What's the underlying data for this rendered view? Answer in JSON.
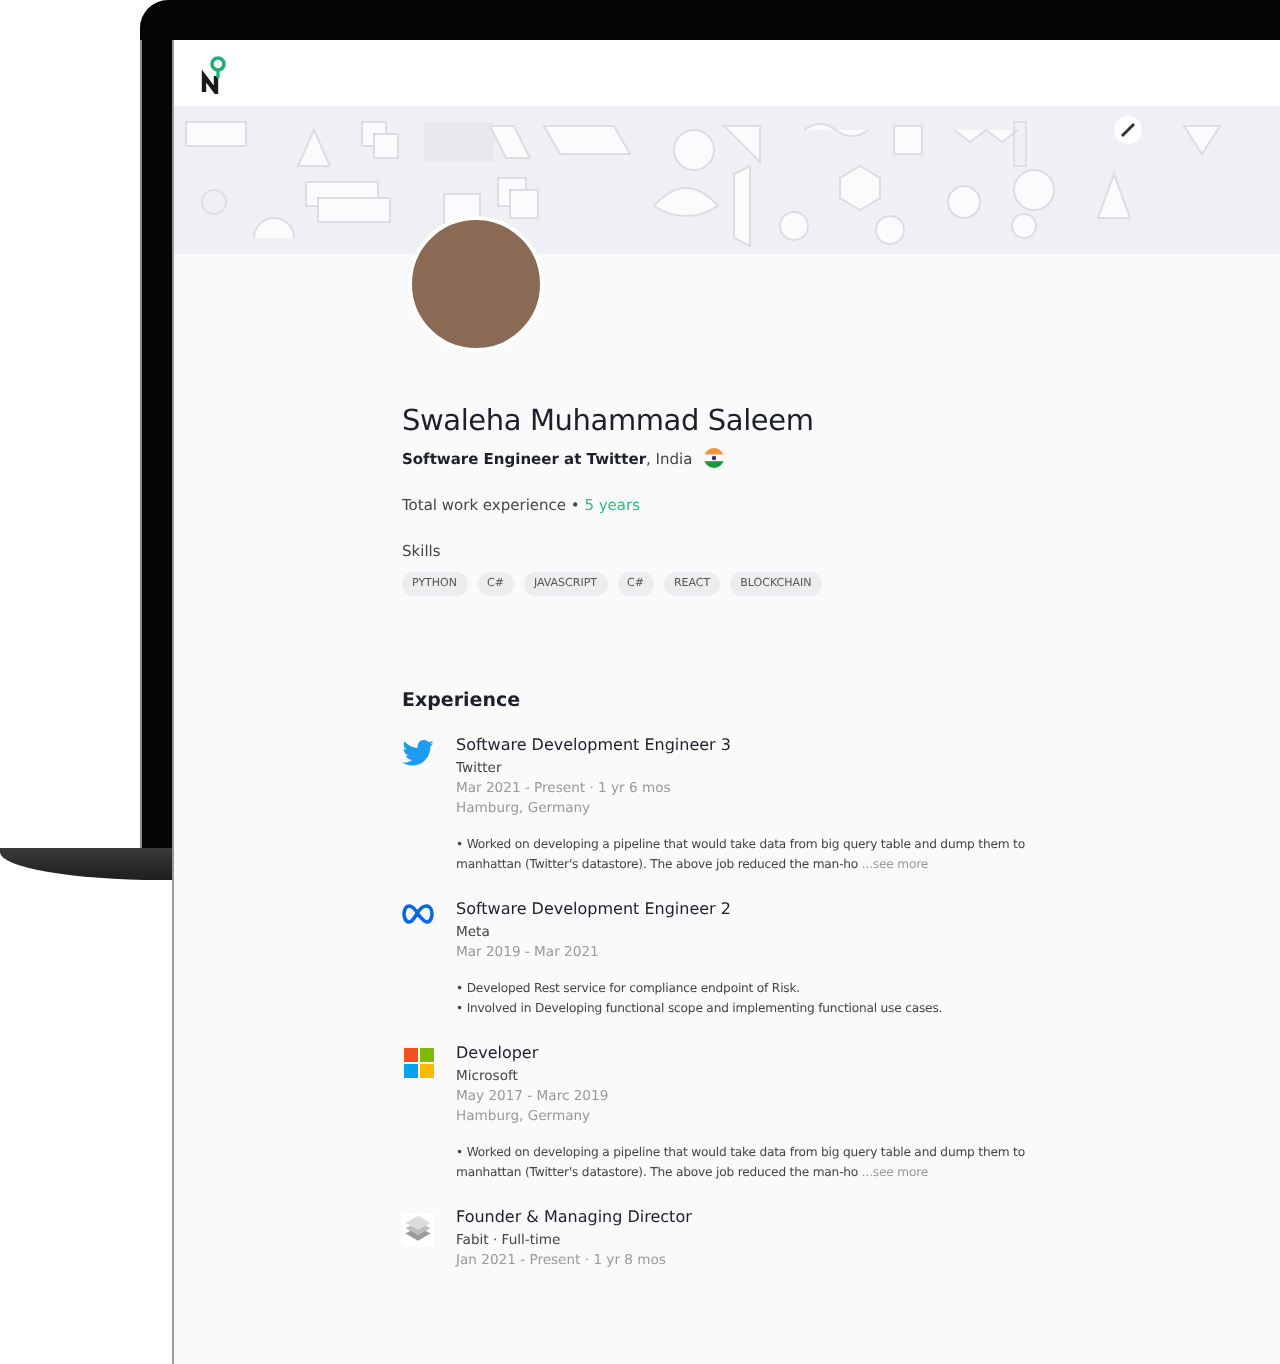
{
  "profile": {
    "name": "Swaleha Muhammad Saleem",
    "headline": "**Software Engineer at Twitter**, India",
    "experience_label": "Total work experience • ",
    "experience_value": "5 years",
    "skills_label": "Skills",
    "skills": [
      "PYTHON",
      "C#",
      "JAVASCRIPT",
      "C#",
      "REACT",
      "BLOCKCHAIN"
    ]
  },
  "experience": {
    "heading": "Experience",
    "items": [
      {
        "kind": "twitter",
        "title": "Software Development Engineer 3",
        "company": "Twitter",
        "dates": "Mar 2021 - Present · 1 yr 6 mos",
        "location": "Hamburg, Germany",
        "bullets": [
          "• Worked on developing a pipeline that would take data from big query table and dump them to manhattan (Twitter's datastore). The above job reduced the man-ho"
        ],
        "see_more": "...see more"
      },
      {
        "kind": "meta",
        "title": "Software Development Engineer 2",
        "company": "Meta",
        "dates": "Mar 2019 - Mar 2021",
        "bullets": [
          "• Developed Rest service for compliance endpoint of Risk.",
          "• Involved in Developing functional scope and implementing functional use cases."
        ]
      },
      {
        "kind": "microsoft",
        "title": "Developer",
        "company": "Microsoft",
        "dates": "May 2017 - Marc 2019",
        "location": "Hamburg, Germany",
        "bullets": [
          "• Worked on developing a pipeline that would take data from big query table and dump them to manhattan (Twitter's datastore). The above job reduced the man-ho"
        ],
        "see_more": "...see more"
      },
      {
        "kind": "layers",
        "title": "Founder & Managing Director",
        "company": "Fabit · Full-time",
        "dates": "Jan 2021 - Present · 1 yr 8 mos"
      }
    ]
  }
}
